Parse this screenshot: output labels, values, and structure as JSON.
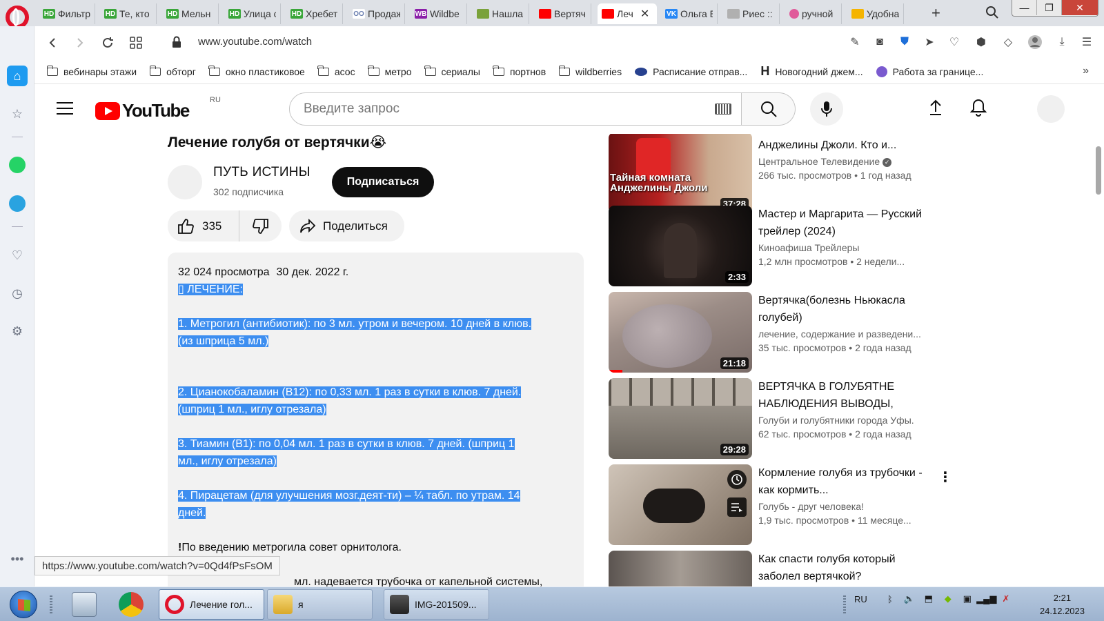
{
  "browser": {
    "tabs": [
      {
        "label": "Фильтр",
        "fav": "HD",
        "color": "#3aa63a"
      },
      {
        "label": "Те, кто",
        "fav": "HD",
        "color": "#3aa63a"
      },
      {
        "label": "Мельн",
        "fav": "HD",
        "color": "#3aa63a"
      },
      {
        "label": "Улица с",
        "fav": "HD",
        "color": "#3aa63a"
      },
      {
        "label": "Хребет",
        "fav": "HD",
        "color": "#3aa63a"
      },
      {
        "label": "Продаж",
        "fav": "OO",
        "color": "#6a7fb0"
      },
      {
        "label": "Wildbe",
        "fav": "WB",
        "color": "#8b1fa9"
      },
      {
        "label": "Нашла",
        "fav": "",
        "color": "#7aa23a"
      },
      {
        "label": "Вертяч",
        "fav": "",
        "color": "#ff0000"
      },
      {
        "label": "Леч",
        "fav": "",
        "color": "#ff0000",
        "active": true
      },
      {
        "label": "Ольга Е",
        "fav": "VK",
        "color": "#2787f5"
      },
      {
        "label": "Риес :: с",
        "fav": "",
        "color": "#b0b0b0"
      },
      {
        "label": "ручной",
        "fav": "",
        "color": "#e05a9a"
      },
      {
        "label": "Удобна",
        "fav": "",
        "color": "#f5b400"
      }
    ],
    "url": "www.youtube.com/watch",
    "bookmarks": [
      {
        "label": "вебинары этажи",
        "type": "folder"
      },
      {
        "label": "обторг",
        "type": "folder"
      },
      {
        "label": "окно пластиковое",
        "type": "folder"
      },
      {
        "label": "асос",
        "type": "folder"
      },
      {
        "label": "метро",
        "type": "folder"
      },
      {
        "label": "сериалы",
        "type": "folder"
      },
      {
        "label": "портнов",
        "type": "folder"
      },
      {
        "label": "wildberries",
        "type": "folder"
      },
      {
        "label": "Расписание отправ...",
        "type": "link"
      },
      {
        "label": "Новогодний джем...",
        "type": "link"
      },
      {
        "label": "Работа за границе...",
        "type": "link"
      }
    ],
    "status_url": "https://www.youtube.com/watch?v=0Qd4fPsFsOM"
  },
  "youtube": {
    "region": "RU",
    "search_placeholder": "Введите запрос",
    "video": {
      "title": "Лечение голубя от вертячки😭",
      "channel": "ПУТЬ ИСТИНЫ",
      "subscribers": "302 подписчика",
      "subscribe_label": "Подписаться",
      "likes": "335",
      "share_label": "Поделиться",
      "views": "32 024 просмотра",
      "date": "30 дек. 2022 г.",
      "description": {
        "heading": "ЛЕЧЕНИЕ:",
        "l1a": "1. Метрогил (антибиотик): по 3 мл. утром и вечером. 10 дней в клюв.",
        "l1b": "(из шприца 5 мл.)",
        "l2a": "2. Цианокобаламин (В12): по 0,33 мл. 1 раз в сутки в клюв. 7 дней.",
        "l2b": "(шприц 1 мл., иглу отрезала)",
        "l3a": "3. Тиамин (В1): по 0,04 мл. 1 раз в сутки в клюв. 7 дней. (шприц 1",
        "l3b": "мл., иглу отрезала)",
        "l4a": "4. Пирацетам (для улучшения мозг.деят-ти) – ¼ табл. по утрам. 14",
        "l4b": "дней.",
        "advice": "По введению метрогила совет орнитолога.",
        "cut": "мл. надевается трубочка от капельной системы,"
      }
    },
    "recommendations": [
      {
        "title": "Анджелины Джоли. Кто и...",
        "channel": "Центральное Телевидение",
        "verified": true,
        "stats": "266 тыс. просмотров  • 1 год назад",
        "duration": "37:28",
        "thumb_text": "Тайная комната Анджелины Джоли"
      },
      {
        "title": "Мастер и Маргарита — Русский трейлер (2024)",
        "channel": "Киноафиша Трейлеры",
        "stats": "1,2 млн просмотров  • 2 недели...",
        "duration": "2:33"
      },
      {
        "title": "Вертячка(болезнь Ньюкасла голубей)",
        "channel": "лечение, содержание и разведени...",
        "stats": "35 тыс. просмотров  • 2 года назад",
        "duration": "21:18"
      },
      {
        "title": "ВЕРТЯЧКА В ГОЛУБЯТНЕ НАБЛЮДЕНИЯ ВЫВОДЫ,",
        "channel": "Голуби и голубятники города Уфы.",
        "stats": "62 тыс. просмотров  • 2 года назад",
        "duration": "29:28"
      },
      {
        "title": "Кормление голубя из трубочки - как кормить...",
        "channel": "Голубь - друг человека!",
        "stats": "1,9 тыс. просмотров  • 11 месяце..."
      },
      {
        "title": "Как спасти голубя который заболел вертячкой?",
        "channel": "",
        "stats": ""
      }
    ]
  },
  "taskbar": {
    "apps": [
      {
        "label": "Лечение гол...",
        "active": true
      },
      {
        "label": "я"
      },
      {
        "label": "IMG-201509..."
      }
    ],
    "lang": "RU",
    "time": "2:21",
    "date": "24.12.2023"
  }
}
